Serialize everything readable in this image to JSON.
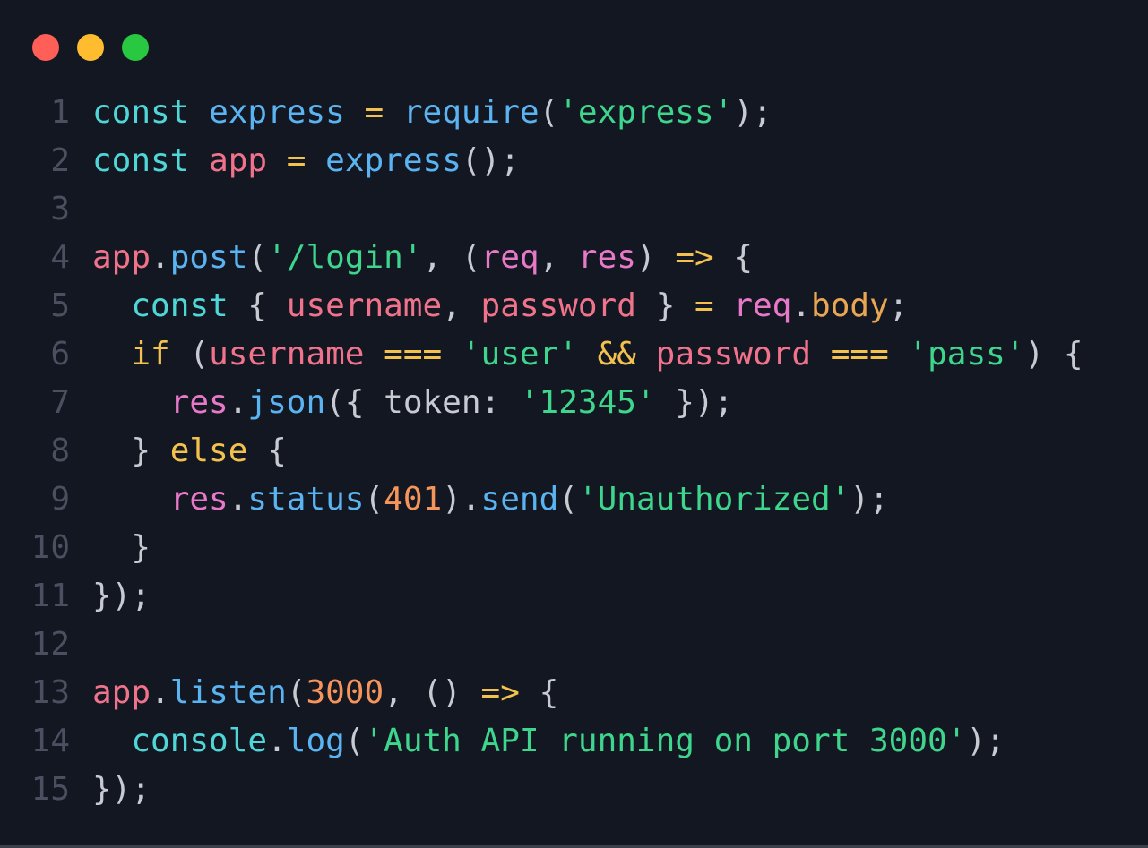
{
  "window": {
    "traffic_lights": [
      {
        "name": "close",
        "color": "#ff5f57"
      },
      {
        "name": "minimize",
        "color": "#febc2e"
      },
      {
        "name": "maximize",
        "color": "#28c840"
      }
    ]
  },
  "code": {
    "line_numbers": [
      "1",
      "2",
      "3",
      "4",
      "5",
      "6",
      "7",
      "8",
      "9",
      "10",
      "11",
      "12",
      "13",
      "14",
      "15"
    ],
    "lines": [
      [
        [
          "kw",
          "const"
        ],
        [
          "pn",
          " "
        ],
        [
          "fn",
          "express"
        ],
        [
          "pn",
          " "
        ],
        [
          "op",
          "="
        ],
        [
          "pn",
          " "
        ],
        [
          "fn",
          "require"
        ],
        [
          "pn",
          "("
        ],
        [
          "st",
          "'express'"
        ],
        [
          "pn",
          ");"
        ]
      ],
      [
        [
          "kw",
          "const"
        ],
        [
          "pn",
          " "
        ],
        [
          "vr",
          "app"
        ],
        [
          "pn",
          " "
        ],
        [
          "op",
          "="
        ],
        [
          "pn",
          " "
        ],
        [
          "fn",
          "express"
        ],
        [
          "pn",
          "();"
        ]
      ],
      [],
      [
        [
          "vr",
          "app"
        ],
        [
          "pn",
          "."
        ],
        [
          "fn",
          "post"
        ],
        [
          "pn",
          "("
        ],
        [
          "st",
          "'/login'"
        ],
        [
          "pn",
          ", ("
        ],
        [
          "pr",
          "req"
        ],
        [
          "pn",
          ", "
        ],
        [
          "pr",
          "res"
        ],
        [
          "pn",
          ") "
        ],
        [
          "ar",
          "=>"
        ],
        [
          "pn",
          " {"
        ]
      ],
      [
        [
          "pn",
          "  "
        ],
        [
          "kw",
          "const"
        ],
        [
          "pn",
          " { "
        ],
        [
          "vr",
          "username"
        ],
        [
          "pn",
          ", "
        ],
        [
          "vr",
          "password"
        ],
        [
          "pn",
          " } "
        ],
        [
          "op",
          "="
        ],
        [
          "pn",
          " "
        ],
        [
          "pr",
          "req"
        ],
        [
          "pn",
          "."
        ],
        [
          "pp",
          "body"
        ],
        [
          "pn",
          ";"
        ]
      ],
      [
        [
          "pn",
          "  "
        ],
        [
          "op",
          "if"
        ],
        [
          "pn",
          " ("
        ],
        [
          "vr",
          "username"
        ],
        [
          "pn",
          " "
        ],
        [
          "op",
          "==="
        ],
        [
          "pn",
          " "
        ],
        [
          "st",
          "'user'"
        ],
        [
          "pn",
          " "
        ],
        [
          "op",
          "&&"
        ],
        [
          "pn",
          " "
        ],
        [
          "vr",
          "password"
        ],
        [
          "pn",
          " "
        ],
        [
          "op",
          "==="
        ],
        [
          "pn",
          " "
        ],
        [
          "st",
          "'pass'"
        ],
        [
          "pn",
          ") {"
        ]
      ],
      [
        [
          "pn",
          "    "
        ],
        [
          "pr",
          "res"
        ],
        [
          "pn",
          "."
        ],
        [
          "fn",
          "json"
        ],
        [
          "pn",
          "({ token: "
        ],
        [
          "st",
          "'12345'"
        ],
        [
          "pn",
          " });"
        ]
      ],
      [
        [
          "pn",
          "  } "
        ],
        [
          "op",
          "else"
        ],
        [
          "pn",
          " {"
        ]
      ],
      [
        [
          "pn",
          "    "
        ],
        [
          "pr",
          "res"
        ],
        [
          "pn",
          "."
        ],
        [
          "fn",
          "status"
        ],
        [
          "pn",
          "("
        ],
        [
          "nm",
          "401"
        ],
        [
          "pn",
          ")."
        ],
        [
          "fn",
          "send"
        ],
        [
          "pn",
          "("
        ],
        [
          "st",
          "'Unauthorized'"
        ],
        [
          "pn",
          ");"
        ]
      ],
      [
        [
          "pn",
          "  }"
        ]
      ],
      [
        [
          "pn",
          "});"
        ]
      ],
      [],
      [
        [
          "vr",
          "app"
        ],
        [
          "pn",
          "."
        ],
        [
          "fn",
          "listen"
        ],
        [
          "pn",
          "("
        ],
        [
          "nm",
          "3000"
        ],
        [
          "pn",
          ", () "
        ],
        [
          "ar",
          "=>"
        ],
        [
          "pn",
          " {"
        ]
      ],
      [
        [
          "pn",
          "  "
        ],
        [
          "kw",
          "console"
        ],
        [
          "pn",
          "."
        ],
        [
          "fn",
          "log"
        ],
        [
          "pn",
          "("
        ],
        [
          "st",
          "'Auth API running on port 3000'"
        ],
        [
          "pn",
          ");"
        ]
      ],
      [
        [
          "pn",
          "});"
        ]
      ]
    ]
  }
}
